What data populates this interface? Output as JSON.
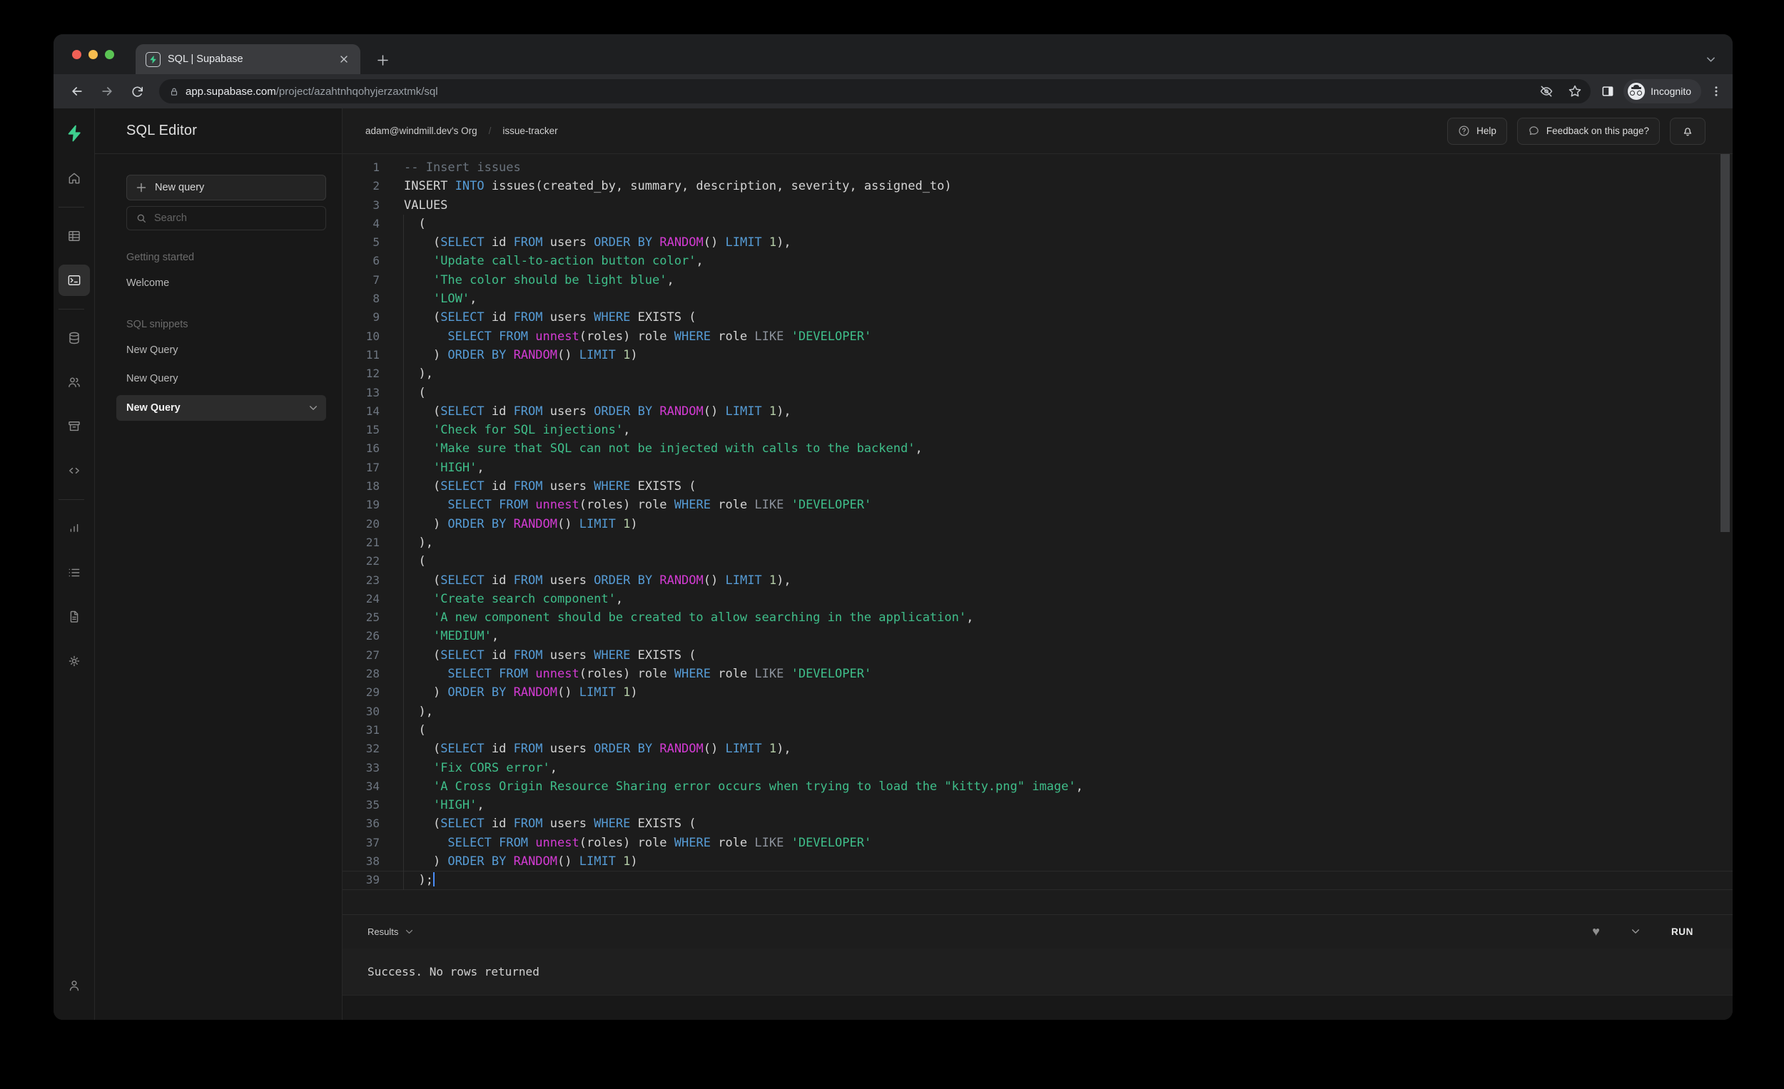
{
  "browser": {
    "tab_title": "SQL | Supabase",
    "url_host": "app.supabase.com",
    "url_path": "/project/azahtnhqohyjerzaxtmk/sql",
    "incognito_label": "Incognito",
    "icons": [
      "back-icon",
      "forward-icon",
      "reload-icon",
      "lock-icon",
      "eye-off-icon",
      "star-icon",
      "side-panel-icon",
      "incognito-icon",
      "menu-dots-icon",
      "new-tab-icon",
      "close-icon",
      "chevron-down-icon"
    ]
  },
  "header": {
    "app_title": "SQL Editor",
    "breadcrumb_org": "adam@windmill.dev's Org",
    "breadcrumb_sep": "/",
    "breadcrumb_project": "issue-tracker",
    "help_label": "Help",
    "feedback_label": "Feedback on this page?",
    "icons": [
      "help-icon",
      "chat-bubble-icon",
      "bell-icon"
    ]
  },
  "sidebar": {
    "new_query_label": "New query",
    "search_placeholder": "Search",
    "sections": [
      {
        "label": "Getting started",
        "items": [
          {
            "label": "Welcome",
            "active": false
          }
        ]
      },
      {
        "label": "SQL snippets",
        "items": [
          {
            "label": "New Query",
            "active": false
          },
          {
            "label": "New Query",
            "active": false
          },
          {
            "label": "New Query",
            "active": true
          }
        ]
      }
    ]
  },
  "rail": {
    "items": [
      {
        "icon": "home",
        "name": "home-icon"
      },
      {
        "divider": true
      },
      {
        "icon": "table",
        "name": "table-editor-icon"
      },
      {
        "icon": "terminal",
        "name": "sql-editor-icon",
        "active": true
      },
      {
        "divider": true
      },
      {
        "icon": "database",
        "name": "database-icon"
      },
      {
        "icon": "users",
        "name": "auth-icon"
      },
      {
        "icon": "storage",
        "name": "storage-icon"
      },
      {
        "icon": "code",
        "name": "functions-icon"
      },
      {
        "divider": true
      },
      {
        "icon": "chart",
        "name": "reports-icon"
      },
      {
        "icon": "list",
        "name": "logs-icon"
      },
      {
        "icon": "file",
        "name": "docs-icon"
      },
      {
        "icon": "gear",
        "name": "settings-icon"
      }
    ],
    "bottom_item": {
      "icon": "person",
      "name": "account-icon"
    }
  },
  "results": {
    "label": "Results",
    "run_label": "RUN",
    "message": "Success. No rows returned",
    "icons": [
      "heart-icon",
      "chevron-down-icon"
    ]
  },
  "colors": {
    "accent_green": "#3ecf8e",
    "keyword": "#569cd6",
    "function": "#d33bd3",
    "string": "#3fbe8a",
    "number": "#b5cea8",
    "comment": "#6a737d",
    "like_operator": "#8c929c",
    "cursor": "#4a8df8"
  },
  "editor": {
    "cursor_line": 39,
    "lines": [
      {
        "n": 1,
        "segs": [
          [
            "-- Insert issues",
            "c"
          ]
        ]
      },
      {
        "n": 2,
        "segs": [
          [
            "INSERT ",
            "t"
          ],
          [
            "INTO",
            "k"
          ],
          [
            " issues(created_by, summary, description, severity, assigned_to)",
            "t"
          ]
        ]
      },
      {
        "n": 3,
        "segs": [
          [
            "VALUES",
            "t"
          ]
        ]
      },
      {
        "n": 4,
        "segs": [
          [
            "  (",
            "t"
          ]
        ]
      },
      {
        "n": 5,
        "segs": [
          [
            "    (",
            "t"
          ],
          [
            "SELECT",
            "k"
          ],
          [
            " id ",
            "t"
          ],
          [
            "FROM",
            "k"
          ],
          [
            " users ",
            "t"
          ],
          [
            "ORDER",
            "k"
          ],
          [
            " ",
            "t"
          ],
          [
            "BY",
            "k"
          ],
          [
            " ",
            "t"
          ],
          [
            "RANDOM",
            "f"
          ],
          [
            "() ",
            "t"
          ],
          [
            "LIMIT",
            "k"
          ],
          [
            " ",
            "t"
          ],
          [
            "1",
            "n"
          ],
          [
            "),",
            "t"
          ]
        ]
      },
      {
        "n": 6,
        "segs": [
          [
            "    ",
            "t"
          ],
          [
            "'Update call-to-action button color'",
            "s"
          ],
          [
            ",",
            "t"
          ]
        ]
      },
      {
        "n": 7,
        "segs": [
          [
            "    ",
            "t"
          ],
          [
            "'The color should be light blue'",
            "s"
          ],
          [
            ",",
            "t"
          ]
        ]
      },
      {
        "n": 8,
        "segs": [
          [
            "    ",
            "t"
          ],
          [
            "'LOW'",
            "s"
          ],
          [
            ",",
            "t"
          ]
        ]
      },
      {
        "n": 9,
        "segs": [
          [
            "    (",
            "t"
          ],
          [
            "SELECT",
            "k"
          ],
          [
            " id ",
            "t"
          ],
          [
            "FROM",
            "k"
          ],
          [
            " users ",
            "t"
          ],
          [
            "WHERE",
            "k"
          ],
          [
            " EXISTS (",
            "t"
          ]
        ]
      },
      {
        "n": 10,
        "segs": [
          [
            "      ",
            "t"
          ],
          [
            "SELECT",
            "k"
          ],
          [
            " ",
            "t"
          ],
          [
            "FROM",
            "k"
          ],
          [
            " ",
            "t"
          ],
          [
            "unnest",
            "f"
          ],
          [
            "(roles) role ",
            "t"
          ],
          [
            "WHERE",
            "k"
          ],
          [
            " role ",
            "t"
          ],
          [
            "LIKE",
            "l"
          ],
          [
            " ",
            "t"
          ],
          [
            "'DEVELOPER'",
            "s"
          ]
        ]
      },
      {
        "n": 11,
        "segs": [
          [
            "    ) ",
            "t"
          ],
          [
            "ORDER",
            "k"
          ],
          [
            " ",
            "t"
          ],
          [
            "BY",
            "k"
          ],
          [
            " ",
            "t"
          ],
          [
            "RANDOM",
            "f"
          ],
          [
            "() ",
            "t"
          ],
          [
            "LIMIT",
            "k"
          ],
          [
            " ",
            "t"
          ],
          [
            "1",
            "n"
          ],
          [
            ")",
            "t"
          ]
        ]
      },
      {
        "n": 12,
        "segs": [
          [
            "  ),",
            "t"
          ]
        ]
      },
      {
        "n": 13,
        "segs": [
          [
            "  (",
            "t"
          ]
        ]
      },
      {
        "n": 14,
        "segs": [
          [
            "    (",
            "t"
          ],
          [
            "SELECT",
            "k"
          ],
          [
            " id ",
            "t"
          ],
          [
            "FROM",
            "k"
          ],
          [
            " users ",
            "t"
          ],
          [
            "ORDER",
            "k"
          ],
          [
            " ",
            "t"
          ],
          [
            "BY",
            "k"
          ],
          [
            " ",
            "t"
          ],
          [
            "RANDOM",
            "f"
          ],
          [
            "() ",
            "t"
          ],
          [
            "LIMIT",
            "k"
          ],
          [
            " ",
            "t"
          ],
          [
            "1",
            "n"
          ],
          [
            "),",
            "t"
          ]
        ]
      },
      {
        "n": 15,
        "segs": [
          [
            "    ",
            "t"
          ],
          [
            "'Check for SQL injections'",
            "s"
          ],
          [
            ",",
            "t"
          ]
        ]
      },
      {
        "n": 16,
        "segs": [
          [
            "    ",
            "t"
          ],
          [
            "'Make sure that SQL can not be injected with calls to the backend'",
            "s"
          ],
          [
            ",",
            "t"
          ]
        ]
      },
      {
        "n": 17,
        "segs": [
          [
            "    ",
            "t"
          ],
          [
            "'HIGH'",
            "s"
          ],
          [
            ",",
            "t"
          ]
        ]
      },
      {
        "n": 18,
        "segs": [
          [
            "    (",
            "t"
          ],
          [
            "SELECT",
            "k"
          ],
          [
            " id ",
            "t"
          ],
          [
            "FROM",
            "k"
          ],
          [
            " users ",
            "t"
          ],
          [
            "WHERE",
            "k"
          ],
          [
            " EXISTS (",
            "t"
          ]
        ]
      },
      {
        "n": 19,
        "segs": [
          [
            "      ",
            "t"
          ],
          [
            "SELECT",
            "k"
          ],
          [
            " ",
            "t"
          ],
          [
            "FROM",
            "k"
          ],
          [
            " ",
            "t"
          ],
          [
            "unnest",
            "f"
          ],
          [
            "(roles) role ",
            "t"
          ],
          [
            "WHERE",
            "k"
          ],
          [
            " role ",
            "t"
          ],
          [
            "LIKE",
            "l"
          ],
          [
            " ",
            "t"
          ],
          [
            "'DEVELOPER'",
            "s"
          ]
        ]
      },
      {
        "n": 20,
        "segs": [
          [
            "    ) ",
            "t"
          ],
          [
            "ORDER",
            "k"
          ],
          [
            " ",
            "t"
          ],
          [
            "BY",
            "k"
          ],
          [
            " ",
            "t"
          ],
          [
            "RANDOM",
            "f"
          ],
          [
            "() ",
            "t"
          ],
          [
            "LIMIT",
            "k"
          ],
          [
            " ",
            "t"
          ],
          [
            "1",
            "n"
          ],
          [
            ")",
            "t"
          ]
        ]
      },
      {
        "n": 21,
        "segs": [
          [
            "  ),",
            "t"
          ]
        ]
      },
      {
        "n": 22,
        "segs": [
          [
            "  (",
            "t"
          ]
        ]
      },
      {
        "n": 23,
        "segs": [
          [
            "    (",
            "t"
          ],
          [
            "SELECT",
            "k"
          ],
          [
            " id ",
            "t"
          ],
          [
            "FROM",
            "k"
          ],
          [
            " users ",
            "t"
          ],
          [
            "ORDER",
            "k"
          ],
          [
            " ",
            "t"
          ],
          [
            "BY",
            "k"
          ],
          [
            " ",
            "t"
          ],
          [
            "RANDOM",
            "f"
          ],
          [
            "() ",
            "t"
          ],
          [
            "LIMIT",
            "k"
          ],
          [
            " ",
            "t"
          ],
          [
            "1",
            "n"
          ],
          [
            "),",
            "t"
          ]
        ]
      },
      {
        "n": 24,
        "segs": [
          [
            "    ",
            "t"
          ],
          [
            "'Create search component'",
            "s"
          ],
          [
            ",",
            "t"
          ]
        ]
      },
      {
        "n": 25,
        "segs": [
          [
            "    ",
            "t"
          ],
          [
            "'A new component should be created to allow searching in the application'",
            "s"
          ],
          [
            ",",
            "t"
          ]
        ]
      },
      {
        "n": 26,
        "segs": [
          [
            "    ",
            "t"
          ],
          [
            "'MEDIUM'",
            "s"
          ],
          [
            ",",
            "t"
          ]
        ]
      },
      {
        "n": 27,
        "segs": [
          [
            "    (",
            "t"
          ],
          [
            "SELECT",
            "k"
          ],
          [
            " id ",
            "t"
          ],
          [
            "FROM",
            "k"
          ],
          [
            " users ",
            "t"
          ],
          [
            "WHERE",
            "k"
          ],
          [
            " EXISTS (",
            "t"
          ]
        ]
      },
      {
        "n": 28,
        "segs": [
          [
            "      ",
            "t"
          ],
          [
            "SELECT",
            "k"
          ],
          [
            " ",
            "t"
          ],
          [
            "FROM",
            "k"
          ],
          [
            " ",
            "t"
          ],
          [
            "unnest",
            "f"
          ],
          [
            "(roles) role ",
            "t"
          ],
          [
            "WHERE",
            "k"
          ],
          [
            " role ",
            "t"
          ],
          [
            "LIKE",
            "l"
          ],
          [
            " ",
            "t"
          ],
          [
            "'DEVELOPER'",
            "s"
          ]
        ]
      },
      {
        "n": 29,
        "segs": [
          [
            "    ) ",
            "t"
          ],
          [
            "ORDER",
            "k"
          ],
          [
            " ",
            "t"
          ],
          [
            "BY",
            "k"
          ],
          [
            " ",
            "t"
          ],
          [
            "RANDOM",
            "f"
          ],
          [
            "() ",
            "t"
          ],
          [
            "LIMIT",
            "k"
          ],
          [
            " ",
            "t"
          ],
          [
            "1",
            "n"
          ],
          [
            ")",
            "t"
          ]
        ]
      },
      {
        "n": 30,
        "segs": [
          [
            "  ),",
            "t"
          ]
        ]
      },
      {
        "n": 31,
        "segs": [
          [
            "  (",
            "t"
          ]
        ]
      },
      {
        "n": 32,
        "segs": [
          [
            "    (",
            "t"
          ],
          [
            "SELECT",
            "k"
          ],
          [
            " id ",
            "t"
          ],
          [
            "FROM",
            "k"
          ],
          [
            " users ",
            "t"
          ],
          [
            "ORDER",
            "k"
          ],
          [
            " ",
            "t"
          ],
          [
            "BY",
            "k"
          ],
          [
            " ",
            "t"
          ],
          [
            "RANDOM",
            "f"
          ],
          [
            "() ",
            "t"
          ],
          [
            "LIMIT",
            "k"
          ],
          [
            " ",
            "t"
          ],
          [
            "1",
            "n"
          ],
          [
            "),",
            "t"
          ]
        ]
      },
      {
        "n": 33,
        "segs": [
          [
            "    ",
            "t"
          ],
          [
            "'Fix CORS error'",
            "s"
          ],
          [
            ",",
            "t"
          ]
        ]
      },
      {
        "n": 34,
        "segs": [
          [
            "    ",
            "t"
          ],
          [
            "'A Cross Origin Resource Sharing error occurs when trying to load the \"kitty.png\" image'",
            "s"
          ],
          [
            ",",
            "t"
          ]
        ]
      },
      {
        "n": 35,
        "segs": [
          [
            "    ",
            "t"
          ],
          [
            "'HIGH'",
            "s"
          ],
          [
            ",",
            "t"
          ]
        ]
      },
      {
        "n": 36,
        "segs": [
          [
            "    (",
            "t"
          ],
          [
            "SELECT",
            "k"
          ],
          [
            " id ",
            "t"
          ],
          [
            "FROM",
            "k"
          ],
          [
            " users ",
            "t"
          ],
          [
            "WHERE",
            "k"
          ],
          [
            " EXISTS (",
            "t"
          ]
        ]
      },
      {
        "n": 37,
        "segs": [
          [
            "      ",
            "t"
          ],
          [
            "SELECT",
            "k"
          ],
          [
            " ",
            "t"
          ],
          [
            "FROM",
            "k"
          ],
          [
            " ",
            "t"
          ],
          [
            "unnest",
            "f"
          ],
          [
            "(roles) role ",
            "t"
          ],
          [
            "WHERE",
            "k"
          ],
          [
            " role ",
            "t"
          ],
          [
            "LIKE",
            "l"
          ],
          [
            " ",
            "t"
          ],
          [
            "'DEVELOPER'",
            "s"
          ]
        ]
      },
      {
        "n": 38,
        "segs": [
          [
            "    ) ",
            "t"
          ],
          [
            "ORDER",
            "k"
          ],
          [
            " ",
            "t"
          ],
          [
            "BY",
            "k"
          ],
          [
            " ",
            "t"
          ],
          [
            "RANDOM",
            "f"
          ],
          [
            "() ",
            "t"
          ],
          [
            "LIMIT",
            "k"
          ],
          [
            " ",
            "t"
          ],
          [
            "1",
            "n"
          ],
          [
            ")",
            "t"
          ]
        ]
      },
      {
        "n": 39,
        "segs": [
          [
            "  );",
            "t"
          ]
        ]
      }
    ]
  }
}
